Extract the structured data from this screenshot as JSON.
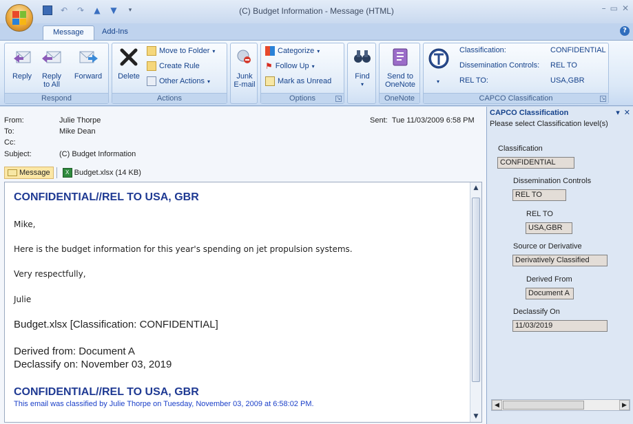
{
  "window": {
    "title": "(C) Budget Information - Message (HTML)"
  },
  "tabs": [
    {
      "label": "Message"
    },
    {
      "label": "Add-Ins"
    }
  ],
  "ribbon": {
    "respond": {
      "label": "Respond",
      "reply": "Reply",
      "reply_all": "Reply\nto All",
      "forward": "Forward"
    },
    "actions": {
      "label": "Actions",
      "delete": "Delete",
      "move_to_folder": "Move to Folder",
      "create_rule": "Create Rule",
      "other_actions": "Other Actions"
    },
    "options_group": {
      "label": "Options",
      "junk": "Junk\nE-mail",
      "categorize": "Categorize",
      "follow_up": "Follow Up",
      "mark_unread": "Mark as Unread",
      "find": "Find"
    },
    "onenote": {
      "label": "OneNote",
      "send": "Send to\nOneNote"
    },
    "capco": {
      "label": "CAPCO Classification",
      "rows": [
        {
          "key": "Classification:",
          "value": "CONFIDENTIAL"
        },
        {
          "key": "Dissemination Controls:",
          "value": "REL TO"
        },
        {
          "key": "REL TO:",
          "value": "USA,GBR"
        }
      ]
    }
  },
  "header": {
    "from_label": "From:",
    "from": "Julie Thorpe",
    "to_label": "To:",
    "to": "Mike Dean",
    "cc_label": "Cc:",
    "cc": "",
    "subject_label": "Subject:",
    "subject": "(C) Budget Information",
    "sent_label": "Sent:",
    "sent": "Tue 11/03/2009 6:58 PM"
  },
  "attachments": [
    {
      "label": "Message"
    },
    {
      "label": "Budget.xlsx (14 KB)"
    }
  ],
  "body": {
    "banner_top": "CONFIDENTIAL//REL TO USA, GBR",
    "greeting": "Mike,",
    "line1": "Here is the budget information for this year's spending on jet propulsion systems.",
    "closing": "Very respectfully,",
    "signature": "Julie",
    "attachment_class": "Budget.xlsx [Classification: CONFIDENTIAL]",
    "derived_from": "Derived from: Document A",
    "declassify_on": "Declassify on: November 03, 2019",
    "banner_bottom": "CONFIDENTIAL//REL TO USA, GBR",
    "footer": "This email was classified by Julie Thorpe on Tuesday, November 03, 2009 at 6:58:02 PM."
  },
  "pane": {
    "title": "CAPCO Classification",
    "subtitle": "Please select Classification level(s)",
    "fields": {
      "classification_label": "Classification",
      "classification": "CONFIDENTIAL",
      "dissem_label": "Dissemination Controls",
      "dissem": "REL TO",
      "relto_label": "REL TO",
      "relto": "USA,GBR",
      "source_label": "Source or Derivative",
      "source": "Derivatively Classified",
      "derived_label": "Derived From",
      "derived": "Document A",
      "declass_label": "Declassify On",
      "declass": "11/03/2019"
    }
  },
  "colors": {
    "banner": "#1f3a93",
    "footer": "#1a3fc8",
    "ribbon_text": "#15428b"
  }
}
